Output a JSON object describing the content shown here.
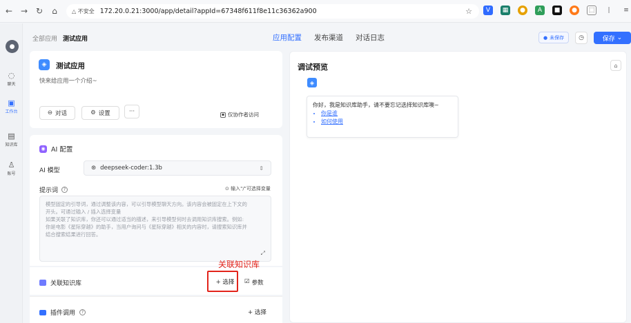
{
  "browser": {
    "insecure_label": "不安全",
    "url": "172.20.0.21:3000/app/detail?appId=67348f611f8e11c36362a900"
  },
  "rail": {
    "items": [
      {
        "label": "聊天",
        "icon": "chat-icon"
      },
      {
        "label": "工作台",
        "icon": "robot-icon"
      },
      {
        "label": "知识库",
        "icon": "database-icon"
      },
      {
        "label": "账号",
        "icon": "user-icon"
      }
    ]
  },
  "header": {
    "breadcrumb_root": "全部应用",
    "breadcrumb_current": "测试应用",
    "tabs": [
      "应用配置",
      "发布渠道",
      "对话日志"
    ],
    "active_tab": "应用配置",
    "unsaved": "未保存",
    "save_label": "保存"
  },
  "app_info": {
    "name": "测试应用",
    "description": "快来给应用一个介绍~",
    "chat_label": "对话",
    "settings_label": "设置",
    "more_label": "···",
    "collab_label": "仅协作者访问"
  },
  "ai_config": {
    "title": "AI 配置",
    "model_label": "AI 模型",
    "model_value": "deepseek-coder:1.3b",
    "prompt_label": "提示词",
    "var_hint": "输入\"/\"可选择变量",
    "prompt_placeholder_lines": [
      "模型固定的引导词，通过调整该内容，可以引导模型聊天方向。该内容会被固定在上下文的",
      "开头。可通过输入 / 插入选择变量",
      "如果关联了知识库，你还可以通过适当的描述，来引导模型何时去调用知识库搜索。例如:",
      "你是电影《星际穿越》的助手，当用户询问与《星际穿越》相关的内容时，请搜索知识库并",
      "结合搜索结果进行回答。"
    ]
  },
  "kb": {
    "title": "关联知识库",
    "select_label": "+ 选择",
    "param_label": "参数",
    "annotation": "关联知识库"
  },
  "plugin": {
    "title": "插件调用",
    "select_label": "+ 选择"
  },
  "debug": {
    "title": "调试预览",
    "greeting": "你好，我是知识库助手，请不要忘记选择知识库噢~",
    "links": [
      "你是谁",
      "如何使用"
    ]
  },
  "colors": {
    "primary": "#3370ff",
    "annotation_red": "#e2231a"
  }
}
